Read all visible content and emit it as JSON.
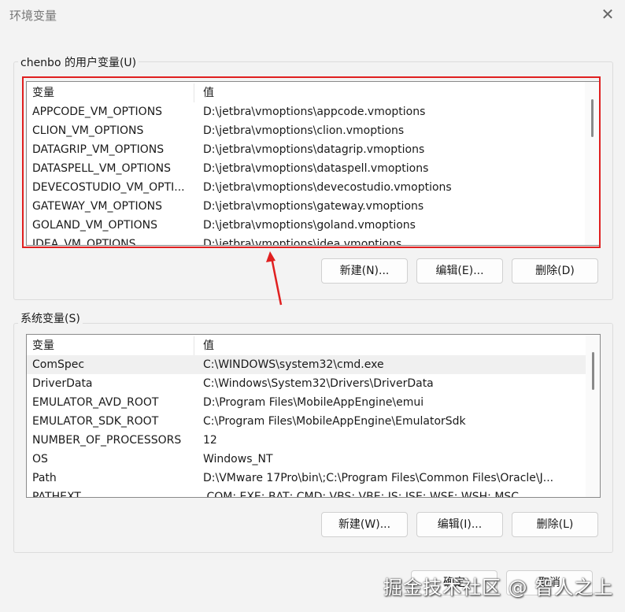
{
  "window": {
    "title": "环境变量",
    "close": "✕"
  },
  "user": {
    "label": "chenbo 的用户变量(U)",
    "header": [
      "变量",
      "值"
    ],
    "rows": [
      [
        "APPCODE_VM_OPTIONS",
        "D:\\jetbra\\vmoptions\\appcode.vmoptions"
      ],
      [
        "CLION_VM_OPTIONS",
        "D:\\jetbra\\vmoptions\\clion.vmoptions"
      ],
      [
        "DATAGRIP_VM_OPTIONS",
        "D:\\jetbra\\vmoptions\\datagrip.vmoptions"
      ],
      [
        "DATASPELL_VM_OPTIONS",
        "D:\\jetbra\\vmoptions\\dataspell.vmoptions"
      ],
      [
        "DEVECOSTUDIO_VM_OPTI...",
        "D:\\jetbra\\vmoptions\\devecostudio.vmoptions"
      ],
      [
        "GATEWAY_VM_OPTIONS",
        "D:\\jetbra\\vmoptions\\gateway.vmoptions"
      ],
      [
        "GOLAND_VM_OPTIONS",
        "D:\\jetbra\\vmoptions\\goland.vmoptions"
      ],
      [
        "IDEA_VM_OPTIONS",
        "D:\\jetbra\\vmoptions\\idea.vmoptions"
      ]
    ],
    "buttons": [
      "新建(N)...",
      "编辑(E)...",
      "删除(D)"
    ]
  },
  "system": {
    "label": "系统变量(S)",
    "header": [
      "变量",
      "值"
    ],
    "rows": [
      [
        "ComSpec",
        "C:\\WINDOWS\\system32\\cmd.exe"
      ],
      [
        "DriverData",
        "C:\\Windows\\System32\\Drivers\\DriverData"
      ],
      [
        "EMULATOR_AVD_ROOT",
        "D:\\Program Files\\MobileAppEngine\\emui"
      ],
      [
        "EMULATOR_SDK_ROOT",
        "C:\\Program Files\\MobileAppEngine\\EmulatorSdk"
      ],
      [
        "NUMBER_OF_PROCESSORS",
        "12"
      ],
      [
        "OS",
        "Windows_NT"
      ],
      [
        "Path",
        "D:\\VMware 17Pro\\bin\\;C:\\Program Files\\Common Files\\Oracle\\J..."
      ],
      [
        "PATHEXT",
        ".COM;.EXE;.BAT;.CMD;.VBS;.VBE;.JS;.JSE;.WSF;.WSH;.MSC"
      ]
    ],
    "buttons": [
      "新建(W)...",
      "编辑(I)...",
      "删除(L)"
    ]
  },
  "footer": {
    "ok": "确定",
    "cancel": "取消"
  },
  "watermark": "掘金技术社区 @ 智人之上",
  "colors": {
    "annotation": "#e02020"
  }
}
